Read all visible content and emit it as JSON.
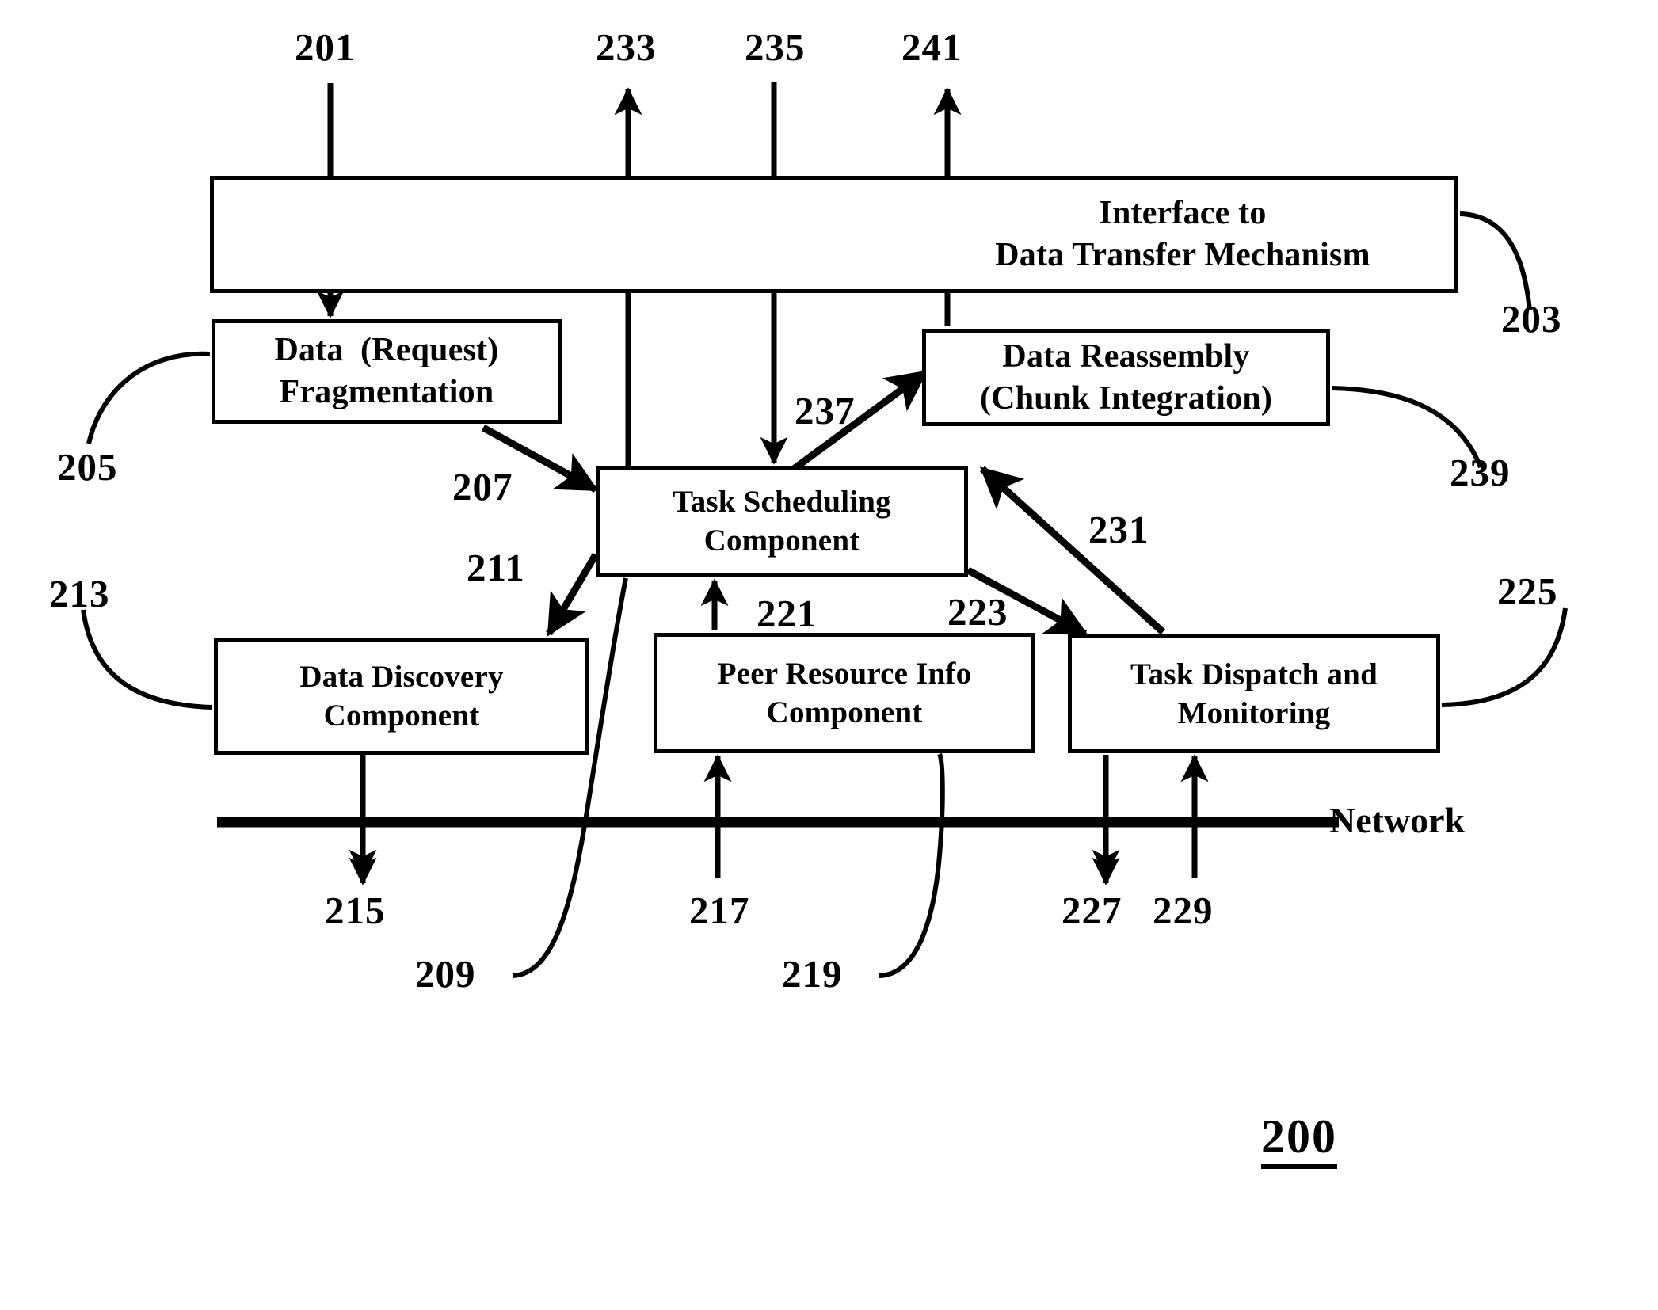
{
  "figure": {
    "number": "200",
    "network_label": "Network"
  },
  "boxes": {
    "interface": {
      "line1": "Interface to",
      "line2": "Data Transfer Mechanism"
    },
    "fragmentation": {
      "line1": "Data  (Request)",
      "line2": "Fragmentation"
    },
    "reassembly": {
      "line1": "Data Reassembly",
      "line2": "(Chunk Integration)"
    },
    "scheduling": {
      "line1": "Task Scheduling",
      "line2": "Component"
    },
    "discovery": {
      "line1": "Data Discovery",
      "line2": "Component"
    },
    "peerinfo": {
      "line1": "Peer Resource Info",
      "line2": "Component"
    },
    "dispatch": {
      "line1": "Task Dispatch and",
      "line2": "Monitoring"
    }
  },
  "refs": {
    "r201": "201",
    "r203": "203",
    "r205": "205",
    "r207": "207",
    "r209": "209",
    "r211": "211",
    "r213": "213",
    "r215": "215",
    "r217": "217",
    "r219": "219",
    "r221": "221",
    "r223": "223",
    "r225": "225",
    "r227": "227",
    "r229": "229",
    "r231": "231",
    "r233": "233",
    "r235": "235",
    "r237": "237",
    "r239": "239",
    "r241": "241"
  },
  "style": {
    "stroke_color": "#000000",
    "fill_color": "#ffffff"
  }
}
